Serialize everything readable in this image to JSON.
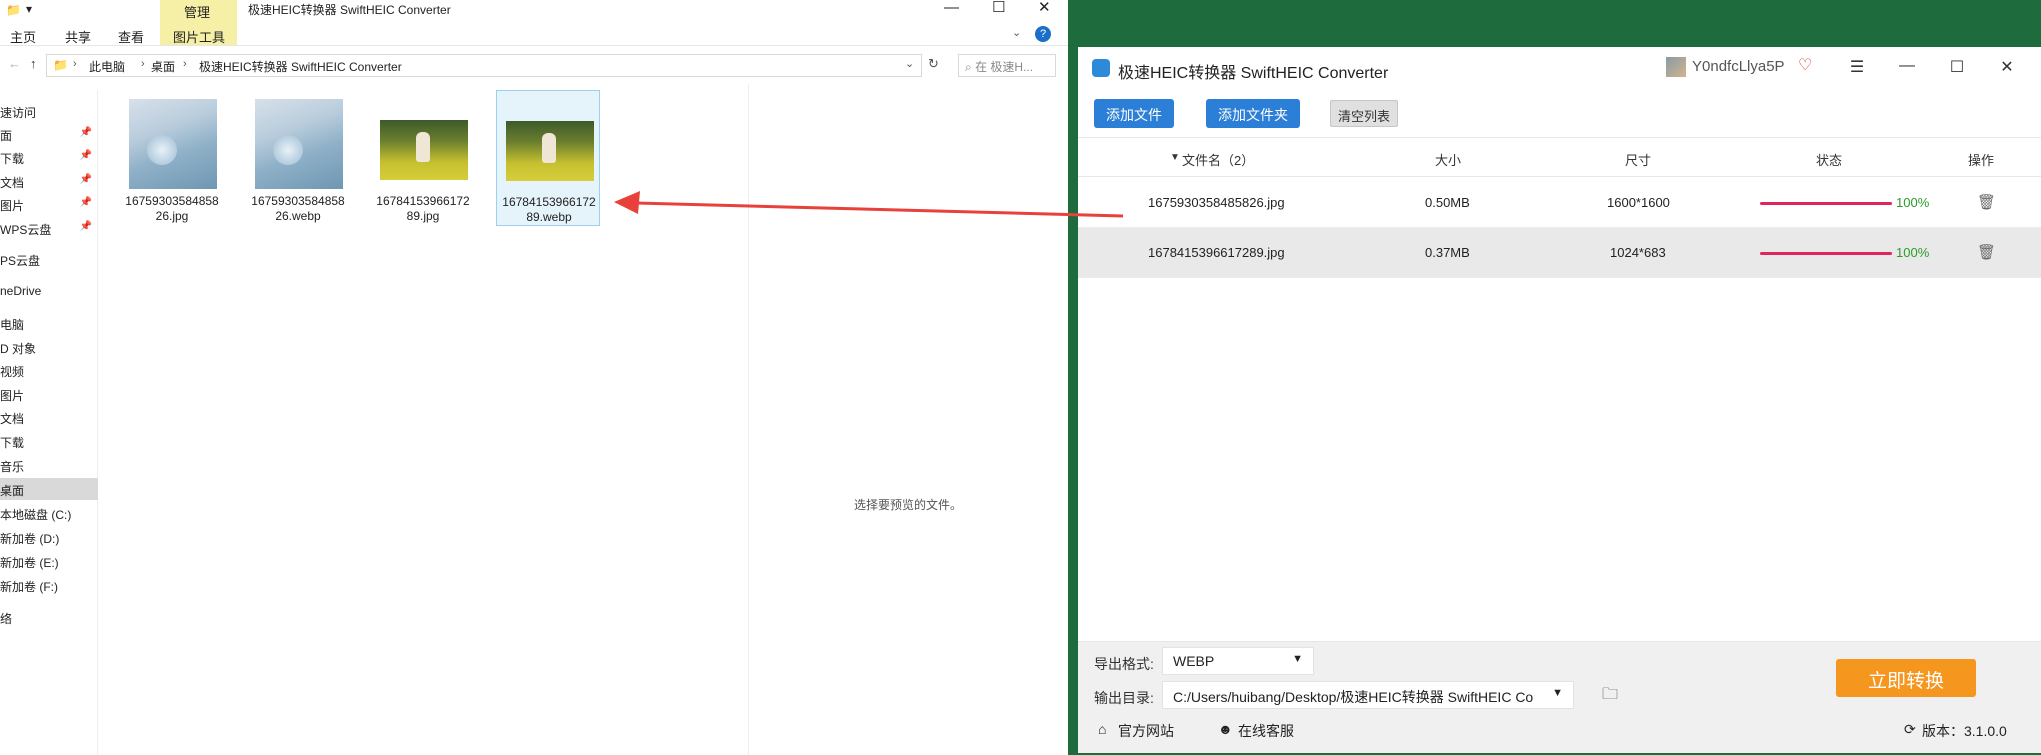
{
  "explorer": {
    "title": "极速HEIC转换器 SwiftHEIC Converter",
    "tabs": {
      "home": "主页",
      "share": "共享",
      "view": "查看",
      "manage": "管理",
      "picture_tools": "图片工具"
    },
    "breadcrumb": {
      "pc": "此电脑",
      "desktop": "桌面",
      "folder": "极速HEIC转换器 SwiftHEIC Converter"
    },
    "search_placeholder": "在 极速H...",
    "nav": [
      {
        "label": "速访问",
        "pinned": false
      },
      {
        "label": "面",
        "pinned": true
      },
      {
        "label": "下载",
        "pinned": true
      },
      {
        "label": "文档",
        "pinned": true
      },
      {
        "label": "图片",
        "pinned": true
      },
      {
        "label": "WPS云盘",
        "pinned": true
      },
      {
        "label": "PS云盘",
        "pinned": false
      },
      {
        "label": "neDrive",
        "pinned": false
      },
      {
        "label": "电脑",
        "pinned": false
      },
      {
        "label": "D 对象",
        "pinned": false
      },
      {
        "label": "视频",
        "pinned": false
      },
      {
        "label": "图片",
        "pinned": false
      },
      {
        "label": "文档",
        "pinned": false
      },
      {
        "label": "下载",
        "pinned": false
      },
      {
        "label": "音乐",
        "pinned": false
      },
      {
        "label": "桌面",
        "pinned": false
      },
      {
        "label": "本地磁盘 (C:)",
        "pinned": false
      },
      {
        "label": "新加卷 (D:)",
        "pinned": false
      },
      {
        "label": "新加卷 (E:)",
        "pinned": false
      },
      {
        "label": "新加卷 (F:)",
        "pinned": false
      },
      {
        "label": "络",
        "pinned": false
      }
    ],
    "files": [
      {
        "name": "1675930358485826.jpg",
        "thumb": "blue"
      },
      {
        "name": "1675930358485826.webp",
        "thumb": "blue"
      },
      {
        "name": "1678415396617289.jpg",
        "thumb": "field"
      },
      {
        "name": "1678415396617289.webp",
        "thumb": "field"
      }
    ],
    "preview_hint": "选择要预览的文件。"
  },
  "converter": {
    "title": "极速HEIC转换器 SwiftHEIC Converter",
    "username": "Y0ndfcLlya5P",
    "buttons": {
      "add_file": "添加文件",
      "add_folder": "添加文件夹",
      "clear": "清空列表",
      "convert": "立即转换"
    },
    "columns": {
      "name": "文件名（2）",
      "size": "大小",
      "dims": "尺寸",
      "status": "状态",
      "op": "操作"
    },
    "rows": [
      {
        "name": "1675930358485826.jpg",
        "size": "0.50MB",
        "dims": "1600*1600",
        "progress": "100%"
      },
      {
        "name": "1678415396617289.jpg",
        "size": "0.37MB",
        "dims": "1024*683",
        "progress": "100%"
      }
    ],
    "format_label": "导出格式:",
    "format_value": "WEBP",
    "output_label": "输出目录:",
    "output_value": "C:/Users/huibang/Desktop/极速HEIC转换器 SwiftHEIC Co",
    "footer": {
      "website": "官方网站",
      "support": "在线客服",
      "version": "版本：3.1.0.0"
    }
  },
  "colors": {
    "accent_blue": "#2b7fd6",
    "convert_orange": "#f5961f",
    "progress_red": "#e0245e",
    "arrow_red": "#e8403a"
  }
}
